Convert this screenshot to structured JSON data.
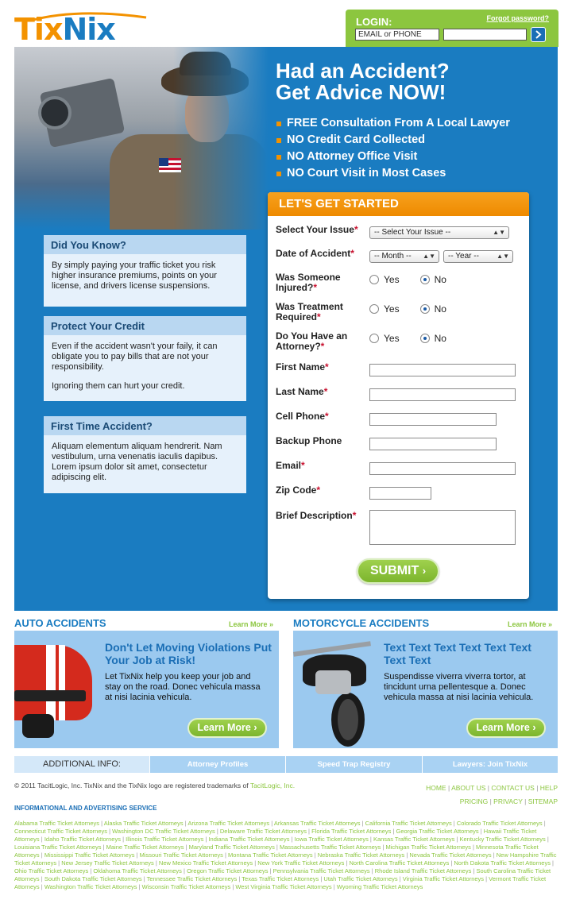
{
  "header": {
    "logo_text_a": "Tix",
    "logo_text_b": "Nix",
    "login_label": "LOGIN:",
    "forgot_password": "Forgot password?",
    "email_placeholder": "EMAIL or PHONE",
    "go_icon": "chevron-right-icon"
  },
  "hero": {
    "headline_line1": "Had an Accident?",
    "headline_line2": "Get Advice NOW!",
    "bullets": [
      "FREE Consultation From A Local Lawyer",
      "NO Credit Card Collected",
      "NO Attorney Office Visit",
      "NO Court Visit in Most Cases"
    ]
  },
  "info_boxes": [
    {
      "title": "Did You Know?",
      "paragraphs": [
        "By simply paying your traffic ticket you risk higher insurance premiums, points on your license, and drivers license suspensions."
      ]
    },
    {
      "title": "Protect Your Credit",
      "paragraphs": [
        "Even if the accident wasn't your faily, it can obligate you to pay bills that are not your responsibility.",
        "Ignoring them can hurt your credit."
      ]
    },
    {
      "title": "First Time Accident?",
      "paragraphs": [
        "Aliquam elementum aliquam hendrerit. Nam vestibulum, urna venenatis iaculis dapibus. Lorem ipsum dolor sit amet, consectetur adipiscing elit."
      ]
    }
  ],
  "form": {
    "title": "LET'S GET STARTED",
    "required_mark": "*",
    "labels": {
      "issue": "Select Your Issue",
      "date": "Date of Accident",
      "injured": [
        "Was Someone",
        "Injured?"
      ],
      "treatment": [
        "Was Treatment",
        "Required"
      ],
      "attorney": [
        "Do You Have an",
        "Attorney?"
      ],
      "first_name": "First Name",
      "last_name": "Last Name",
      "cell": "Cell Phone",
      "backup": "Backup Phone",
      "email": "Email",
      "zip": "Zip Code",
      "description": "Brief Description"
    },
    "selects": {
      "issue": "-- Select Your Issue --",
      "month": "-- Month --",
      "year": "-- Year --"
    },
    "radio_yes": "Yes",
    "radio_no": "No",
    "radio_selected": "No",
    "submit": "SUBMIT"
  },
  "promos": {
    "learn_more_small": "Learn More »",
    "learn_more_button": "Learn More",
    "auto": {
      "section_title": "AUTO ACCIDENTS",
      "headline": "Don't Let Moving Violations Put Your Job at Risk!",
      "body": "Let TixNix help you keep your job and stay on the road. Donec vehicula massa at nisi lacinia vehicula."
    },
    "moto": {
      "section_title": "MOTORCYCLE ACCIDENTS",
      "headline": "Text Text Text Text Text Text Text Text",
      "body": "Suspendisse viverra viverra tortor, at tincidunt urna pellentesque a. Donec vehicula massa at nisi lacinia vehicula."
    }
  },
  "additional_info": {
    "label": "ADDITIONAL INFO:",
    "links": [
      "Attorney Profiles",
      "Speed Trap Registry",
      "Lawyers: Join TixNix"
    ]
  },
  "footer": {
    "copyright_a": "© 2011 TacitLogic, Inc. TixNix and the TixNix logo are registered trademarks of ",
    "copyright_link": "TacitLogic, Inc.",
    "nav_row1": [
      "HOME",
      "ABOUT US",
      "CONTACT US",
      "HELP"
    ],
    "nav_row2": [
      "PRICING",
      "PRIVACY",
      "SITEMAP"
    ],
    "service_title": "INFORMATIONAL AND ADVERTISING SERVICE",
    "state_links": [
      "Alabama Traffic Ticket Attorneys",
      "Alaska Traffic Ticket Attorneys",
      "Arizona Traffic Ticket Attorneys",
      "Arkansas Traffic Ticket Attorneys",
      "California Traffic Ticket Attorneys",
      "Colorado Traffic Ticket Attorneys",
      "Connecticut Traffic Ticket Attorneys",
      "Washington DC Traffic Ticket Attorneys",
      "Delaware Traffic Ticket Attorneys",
      "Florida Traffic Ticket Attorneys",
      "Georgia Traffic Ticket Attorneys",
      "Hawaii Traffic Ticket Attorneys",
      "Idaho Traffic Ticket Attorneys",
      "Illinois Traffic Ticket Attorneys",
      "Indiana Traffic Ticket Attorneys",
      "Iowa Traffic Ticket Attorneys",
      "Kansas Traffic Ticket Attorneys",
      "Kentucky Traffic Ticket Attorneys",
      "Louisiana Traffic Ticket Attorneys",
      "Maine Traffic Ticket Attorneys",
      "Maryland Traffic Ticket Attorneys",
      "Massachusetts Traffic Ticket Attorneys",
      "Michigan Traffic Ticket Attorneys",
      "Minnesota Traffic Ticket Attorneys",
      "Mississippi Traffic Ticket Attorneys",
      "Missouri Traffic Ticket Attorneys",
      "Montana Traffic Ticket Attorneys",
      "Nebraska Traffic Ticket Attorneys",
      "Nevada Traffic Ticket Attorneys",
      "New Hampshire Traffic Ticket Attorneys",
      "New Jersey Traffic Ticket Attorneys",
      "New Mexico Traffic Ticket Attorneys",
      "New York Traffic Ticket Attorneys",
      "North Carolina Traffic Ticket Attorneys",
      "North Dakota Traffic Ticket Attorneys",
      "Ohio Traffic Ticket Attorneys",
      "Oklahoma Traffic Ticket Attorneys",
      "Oregon Traffic Ticket Attorneys",
      "Pennsylvania Traffic Ticket Attorneys",
      "Rhode Island Traffic Ticket Attorneys",
      "South Carolina Traffic Ticket Attorneys",
      "South Dakota Traffic Ticket Attorneys",
      "Tennessee Traffic Ticket Attorneys",
      "Texas Traffic Ticket Attorneys",
      "Utah Traffic Ticket Attorneys",
      "Virginia Traffic Ticket Attorneys",
      "Vermont Traffic Ticket Attorneys",
      "Washington Traffic Ticket Attorneys",
      "Wisconsin Traffic Ticket Attorneys",
      "West Virginia Traffic Ticket Attorneys",
      "Wyoming Traffic Ticket Attorneys"
    ]
  },
  "colors": {
    "brand_blue": "#1a7cc1",
    "brand_orange": "#f39200",
    "brand_green": "#8cc63f"
  }
}
